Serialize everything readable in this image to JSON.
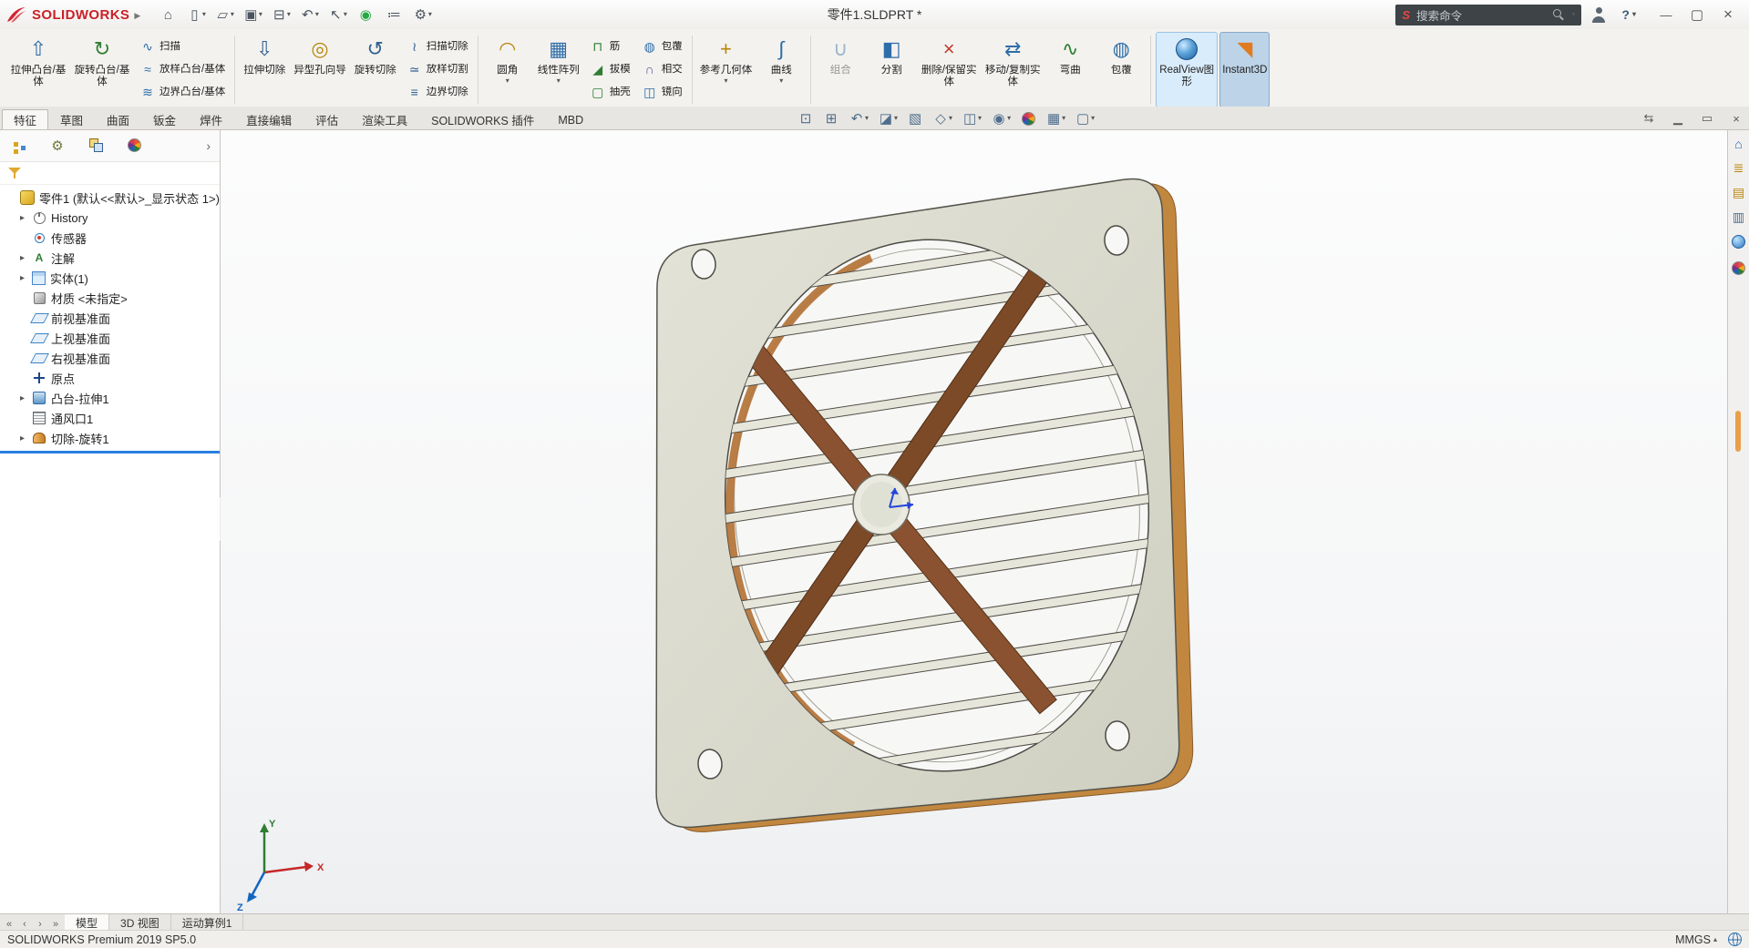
{
  "titlebar": {
    "app_name": "SOLIDWORKS",
    "doc_title": "零件1.SLDPRT *",
    "search_text": "搜索命令",
    "help_label": "?",
    "quick_tools": [
      {
        "name": "home"
      },
      {
        "name": "new-document",
        "caret": true
      },
      {
        "name": "open",
        "caret": true
      },
      {
        "name": "save",
        "caret": true
      },
      {
        "name": "print",
        "caret": true
      },
      {
        "name": "undo",
        "caret": true
      },
      {
        "name": "select",
        "caret": true
      },
      {
        "name": "rebuild"
      },
      {
        "name": "file-properties"
      },
      {
        "name": "options",
        "caret": true
      }
    ]
  },
  "ribbon": {
    "groups": [
      {
        "buttons": [
          {
            "label": "拉伸凸台/基体",
            "icon": "extrude-boss",
            "size": "big"
          },
          {
            "label": "旋转凸台/基体",
            "icon": "revolve-boss",
            "size": "big"
          },
          {
            "stack": [
              {
                "label": "扫描",
                "icon": "sweep"
              },
              {
                "label": "放样凸台/基体",
                "icon": "loft"
              },
              {
                "label": "边界凸台/基体",
                "icon": "boundary"
              }
            ]
          }
        ]
      },
      {
        "buttons": [
          {
            "label": "拉伸切除",
            "icon": "extrude-cut",
            "size": "big"
          },
          {
            "label": "异型孔向导",
            "icon": "hole-wizard",
            "size": "big"
          },
          {
            "label": "旋转切除",
            "icon": "revolve-cut",
            "size": "big"
          },
          {
            "stack": [
              {
                "label": "扫描切除",
                "icon": "sweep-cut"
              },
              {
                "label": "放样切割",
                "icon": "loft-cut"
              },
              {
                "label": "边界切除",
                "icon": "boundary-cut"
              }
            ]
          }
        ]
      },
      {
        "buttons": [
          {
            "label": "圆角",
            "icon": "fillet",
            "size": "big",
            "caret": true
          },
          {
            "label": "线性阵列",
            "icon": "linear-pattern",
            "size": "big",
            "caret": true
          },
          {
            "stack": [
              {
                "label": "筋",
                "icon": "rib"
              },
              {
                "label": "拔模",
                "icon": "draft"
              },
              {
                "label": "抽壳",
                "icon": "shell"
              }
            ]
          },
          {
            "stack": [
              {
                "label": "包覆",
                "icon": "wrap"
              },
              {
                "label": "相交",
                "icon": "intersect"
              },
              {
                "label": "镜向",
                "icon": "mirror"
              }
            ]
          }
        ]
      },
      {
        "buttons": [
          {
            "label": "参考几何体",
            "icon": "reference-geometry",
            "size": "big",
            "caret": true
          },
          {
            "label": "曲线",
            "icon": "curves",
            "size": "big",
            "caret": true
          }
        ]
      },
      {
        "buttons": [
          {
            "label": "组合",
            "icon": "combine",
            "size": "big",
            "disabled": true
          },
          {
            "label": "分割",
            "icon": "split",
            "size": "big"
          },
          {
            "label": "删除/保留实体",
            "icon": "delete-keep-body",
            "size": "big"
          },
          {
            "label": "移动/复制实体",
            "icon": "move-copy-body",
            "size": "big"
          },
          {
            "label": "弯曲",
            "icon": "flex",
            "size": "big"
          },
          {
            "label": "包覆",
            "icon": "wrap",
            "size": "big"
          }
        ]
      },
      {
        "buttons": [
          {
            "label": "RealView图形",
            "icon": "realview",
            "size": "big",
            "highlight": true
          },
          {
            "label": "Instant3D",
            "icon": "instant3d",
            "size": "big",
            "active": true
          }
        ]
      }
    ]
  },
  "tabs": {
    "items": [
      {
        "label": "特征",
        "active": true
      },
      {
        "label": "草图"
      },
      {
        "label": "曲面"
      },
      {
        "label": "钣金"
      },
      {
        "label": "焊件"
      },
      {
        "label": "直接编辑"
      },
      {
        "label": "评估"
      },
      {
        "label": "渲染工具"
      },
      {
        "label": "SOLIDWORKS 插件"
      },
      {
        "label": "MBD"
      }
    ]
  },
  "headsup": {
    "items": [
      {
        "name": "zoom-fit"
      },
      {
        "name": "zoom-area"
      },
      {
        "name": "previous-view",
        "caret": true
      },
      {
        "name": "section-view",
        "caret": true
      },
      {
        "name": "dynamic-annotation"
      },
      {
        "name": "view-orientation",
        "caret": true
      },
      {
        "name": "display-style",
        "caret": true
      },
      {
        "name": "hide-show-items",
        "caret": true
      },
      {
        "name": "edit-appearance"
      },
      {
        "name": "apply-scene",
        "caret": true
      },
      {
        "name": "view-settings",
        "caret": true
      }
    ]
  },
  "doc_window_controls": {
    "items": [
      {
        "name": "doc-pane"
      },
      {
        "name": "doc-minimize"
      },
      {
        "name": "doc-restore"
      },
      {
        "name": "doc-close"
      }
    ]
  },
  "feature_manager": {
    "manager_tabs": [
      {
        "name": "featuremanager-tree",
        "active": true
      },
      {
        "name": "propertymanager"
      },
      {
        "name": "configurationmanager"
      },
      {
        "name": "displaymanager"
      }
    ],
    "root": {
      "label": "零件1 (默认<<默认>_显示状态 1>)",
      "icon": "part"
    },
    "items": [
      {
        "label": "History",
        "icon": "history",
        "expand": true
      },
      {
        "label": "传感器",
        "icon": "sensors"
      },
      {
        "label": "注解",
        "icon": "annotations",
        "expand": true
      },
      {
        "label": "实体(1)",
        "icon": "solid-bodies",
        "expand": true
      },
      {
        "label": "材质 <未指定>",
        "icon": "material"
      },
      {
        "label": "前视基准面",
        "icon": "plane"
      },
      {
        "label": "上视基准面",
        "icon": "plane"
      },
      {
        "label": "右视基准面",
        "icon": "plane"
      },
      {
        "label": "原点",
        "icon": "origin"
      },
      {
        "label": "凸台-拉伸1",
        "icon": "boss-extrude",
        "expand": true
      },
      {
        "label": "通风口1",
        "icon": "vent"
      },
      {
        "label": "切除-旋转1",
        "icon": "cut-revolve",
        "expand": true
      }
    ]
  },
  "viewport": {
    "triad": {
      "x": "X",
      "y": "Y",
      "z": "Z"
    }
  },
  "taskpane": {
    "items": [
      {
        "name": "solidworks-resources"
      },
      {
        "name": "design-library"
      },
      {
        "name": "file-explorer"
      },
      {
        "name": "view-palette"
      },
      {
        "name": "appearances-scenes"
      },
      {
        "name": "custom-properties"
      }
    ]
  },
  "bottom_tabs": {
    "nav": [
      {
        "name": "tabs-first"
      },
      {
        "name": "tabs-prev"
      },
      {
        "name": "tabs-next"
      },
      {
        "name": "tabs-last"
      }
    ],
    "items": [
      {
        "label": "模型",
        "active": true
      },
      {
        "label": "3D 视图"
      },
      {
        "label": "运动算例1"
      }
    ]
  },
  "statusbar": {
    "left": "SOLIDWORKS Premium 2019 SP5.0",
    "units": "MMGS"
  }
}
